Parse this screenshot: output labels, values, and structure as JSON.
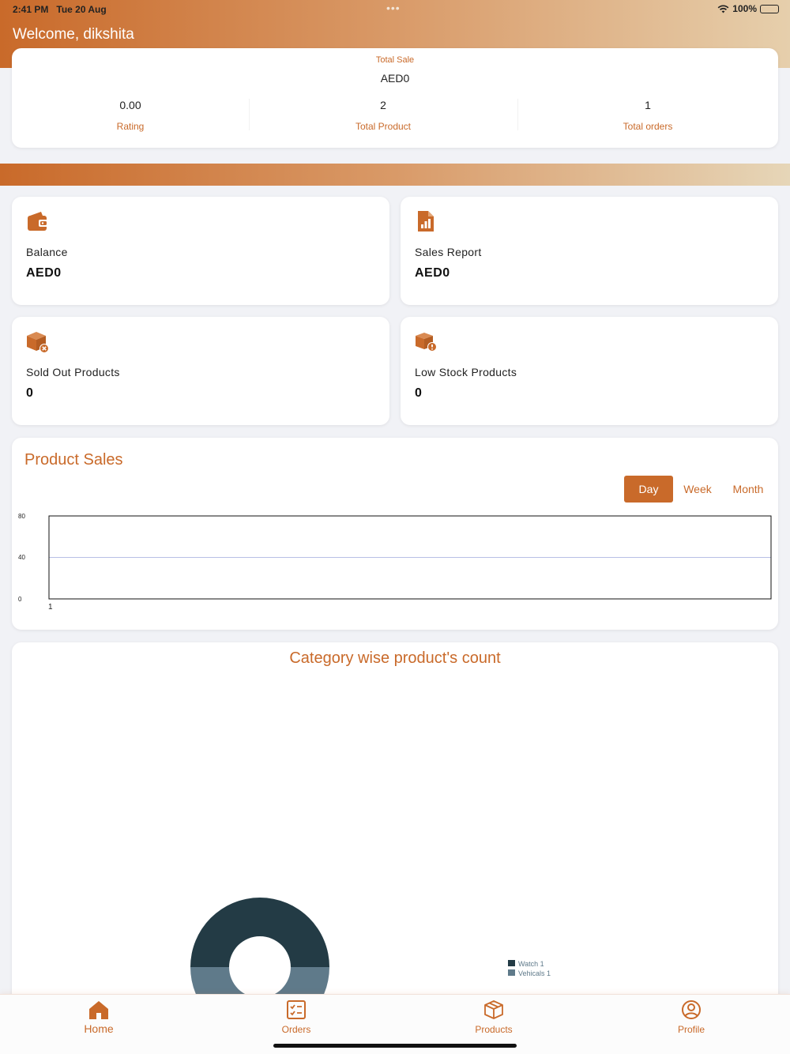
{
  "status_bar": {
    "time": "2:41 PM",
    "date": "Tue 20 Aug",
    "battery": "100%"
  },
  "header": {
    "welcome": "Welcome, dikshita"
  },
  "summary": {
    "total_sale_label": "Total Sale",
    "total_sale_value": "AED0",
    "stats": [
      {
        "value": "0.00",
        "label": "Rating"
      },
      {
        "value": "2",
        "label": "Total Product"
      },
      {
        "value": "1",
        "label": "Total orders"
      }
    ]
  },
  "tiles": [
    {
      "icon": "wallet-icon",
      "label": "Balance",
      "value": "AED0"
    },
    {
      "icon": "report-icon",
      "label": "Sales Report",
      "value": "AED0"
    },
    {
      "icon": "box-x-icon",
      "label": "Sold Out Products",
      "value": "0"
    },
    {
      "icon": "box-alert-icon",
      "label": "Low Stock Products",
      "value": "0"
    }
  ],
  "product_sales": {
    "title": "Product Sales",
    "segments": [
      {
        "label": "Day",
        "active": true
      },
      {
        "label": "Week",
        "active": false
      },
      {
        "label": "Month",
        "active": false
      }
    ]
  },
  "chart_data": [
    {
      "type": "line",
      "title": "Product Sales",
      "categories": [
        "1"
      ],
      "series": [],
      "yticks": [
        "80",
        "40",
        "0"
      ],
      "ylim": [
        0,
        80
      ],
      "grid": true
    },
    {
      "type": "pie",
      "title": "Category wise product's count",
      "slices": [
        {
          "name": "Watch",
          "value": 1,
          "legend": "Watch 1",
          "color": "#233b45"
        },
        {
          "name": "Vehicals",
          "value": 1,
          "legend": "Vehicals 1",
          "color": "#5f7a8a"
        }
      ],
      "legend_placement": "right"
    }
  ],
  "category_chart": {
    "title": "Category wise product's count"
  },
  "tabs": [
    {
      "label": "Home",
      "icon": "home-icon",
      "active": true
    },
    {
      "label": "Orders",
      "icon": "orders-icon",
      "active": false
    },
    {
      "label": "Products",
      "icon": "products-icon",
      "active": false
    },
    {
      "label": "Profile",
      "icon": "profile-icon",
      "active": false
    }
  ],
  "colors": {
    "accent": "#c96a2a",
    "dark_slice": "#233b45",
    "light_slice": "#5f7a8a"
  }
}
